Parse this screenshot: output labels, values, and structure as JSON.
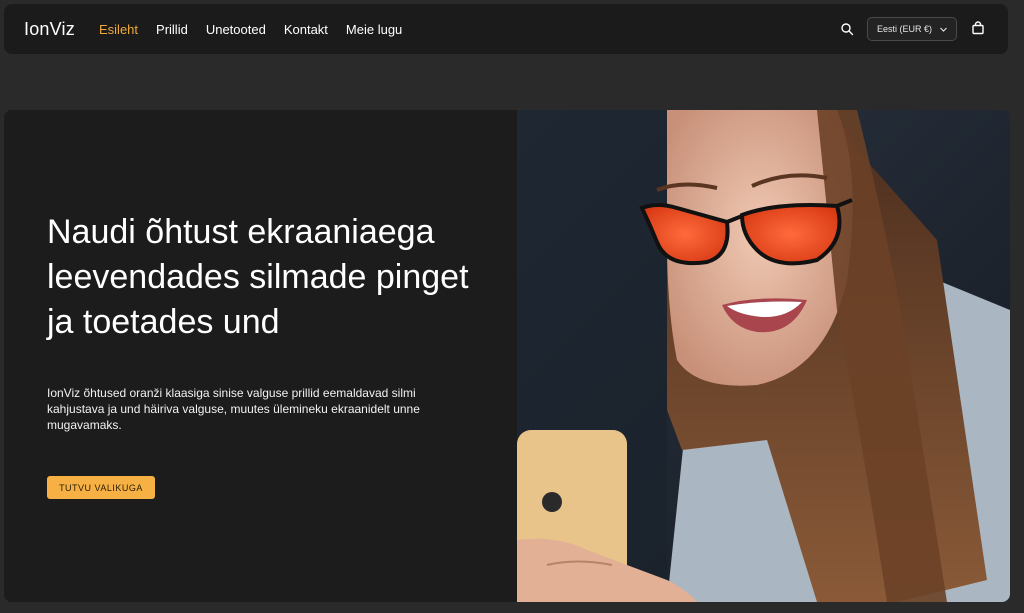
{
  "header": {
    "logo": "IonViz",
    "nav": [
      {
        "label": "Esileht",
        "active": true
      },
      {
        "label": "Prillid"
      },
      {
        "label": "Unetooted"
      },
      {
        "label": "Kontakt"
      },
      {
        "label": "Meie lugu"
      }
    ],
    "locale": "Eesti (EUR €)",
    "icons": {
      "search": "search-icon",
      "chevron": "chevron-down-icon",
      "cart": "shopping-bag-icon"
    }
  },
  "hero": {
    "title": "Naudi õhtust ekraaniaega leevendades silmade pinget ja toetades und",
    "description": "IonViz õhtused oranži klaasiga sinise valguse prillid eemaldavad silmi kahjustava ja und häiriva valguse, muutes ülemineku ekraanidelt unne mugavamaks.",
    "cta": "TUTVU VALIKUGA"
  },
  "colors": {
    "accent": "#f2a93b",
    "button": "#f6b043",
    "header_bg": "#1b1b1c",
    "page_bg": "#2a2a2a",
    "hero_bg": "#1c1c1d"
  }
}
